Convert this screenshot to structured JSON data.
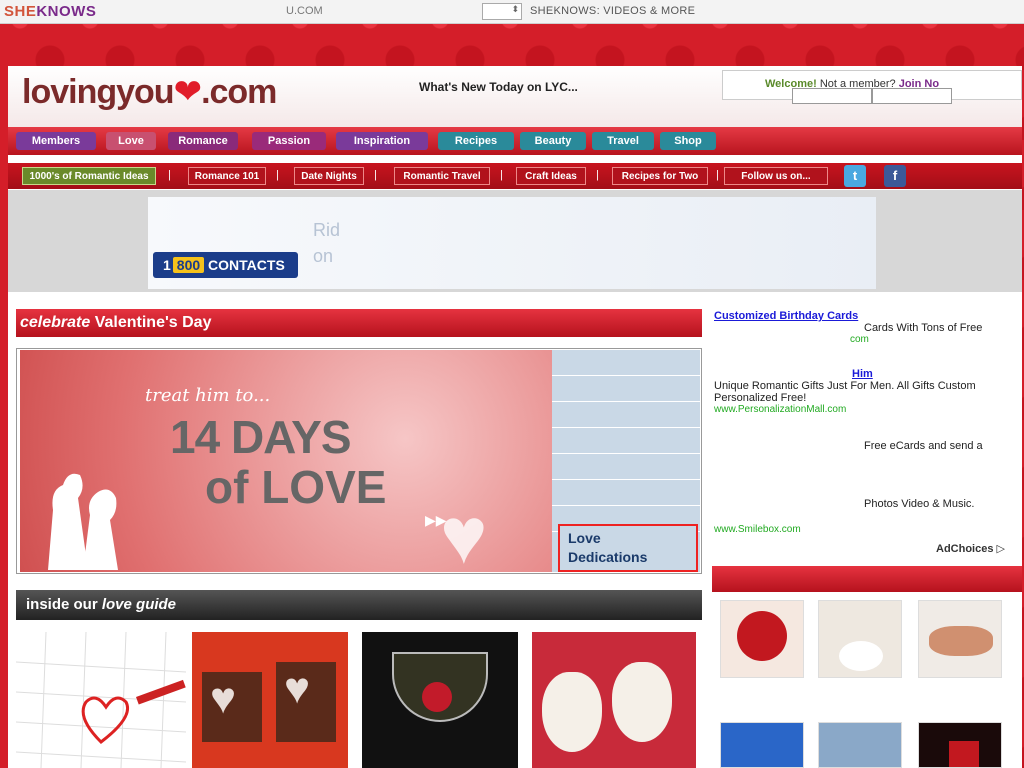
{
  "topbar": {
    "brand_she": "SHE",
    "brand_knows": "KNOWS",
    "site_text": "U.COM",
    "select_arrow": "⬍",
    "section_title": "SHEKNOWS: VIDEOS & MORE"
  },
  "header": {
    "logo_pre": "lovingyou",
    "logo_heart": "❤",
    "logo_post": ".com",
    "whats_new": "What's New Today on LYC...",
    "welcome": "Welcome!",
    "not_member": "Not a member?",
    "join": "Join No"
  },
  "nav": {
    "tabs": [
      {
        "label": "Members",
        "color": "#7a3a9a"
      },
      {
        "label": "Love",
        "color": "#c85070"
      },
      {
        "label": "Romance",
        "color": "#8a2a7a"
      },
      {
        "label": "Passion",
        "color": "#9a2a7a"
      },
      {
        "label": "Inspiration",
        "color": "#7a3a9a"
      },
      {
        "label": "Recipes",
        "color": "#2a8a9a"
      },
      {
        "label": "Beauty",
        "color": "#2a8a9a"
      },
      {
        "label": "Travel",
        "color": "#2a8a9a"
      },
      {
        "label": "Shop",
        "color": "#2a8a9a"
      }
    ]
  },
  "subnav": {
    "items": [
      "1000's of Romantic Ideas",
      "Romance 101",
      "Date Nights",
      "Romantic Travel",
      "Craft Ideas",
      "Recipes for Two",
      "Follow us on..."
    ],
    "twitter_icon": "t",
    "facebook_icon": "f",
    "separator": "|"
  },
  "ad_banner": {
    "ghost_text": "Rid\non",
    "contacts_prefix": "1",
    "contacts_num": "800",
    "contacts_word": "CONTACTS"
  },
  "valentine": {
    "heading_italic": "celebrate",
    "heading_rest": " Valentine's Day",
    "feature_line1": "treat him to...",
    "feature_line2": "14 DAYS",
    "feature_line3": "of LOVE",
    "play_icon": "▶▶",
    "side_items": [
      "",
      "",
      "",
      "",
      "",
      "",
      ""
    ],
    "active_item": "Love\nDedications"
  },
  "guide": {
    "heading_rest": "inside our ",
    "heading_italic": "love guide"
  },
  "right_ads": {
    "ad1_title": "Customized Birthday Cards",
    "ad1_text": "Cards With Tons of Free",
    "ad1_url": "com",
    "ad2_title": "Him",
    "ad2_text": "Unique Romantic Gifts Just For Men. All Gifts Custom",
    "ad2_text2": "Personalized Free!",
    "ad2_url": "www.PersonalizationMall.com",
    "ad3_text": "Free eCards and send a",
    "ad4_text": "Photos Video & Music.",
    "ad4_url": "www.Smilebox.com",
    "adchoices": "AdChoices ▷"
  }
}
